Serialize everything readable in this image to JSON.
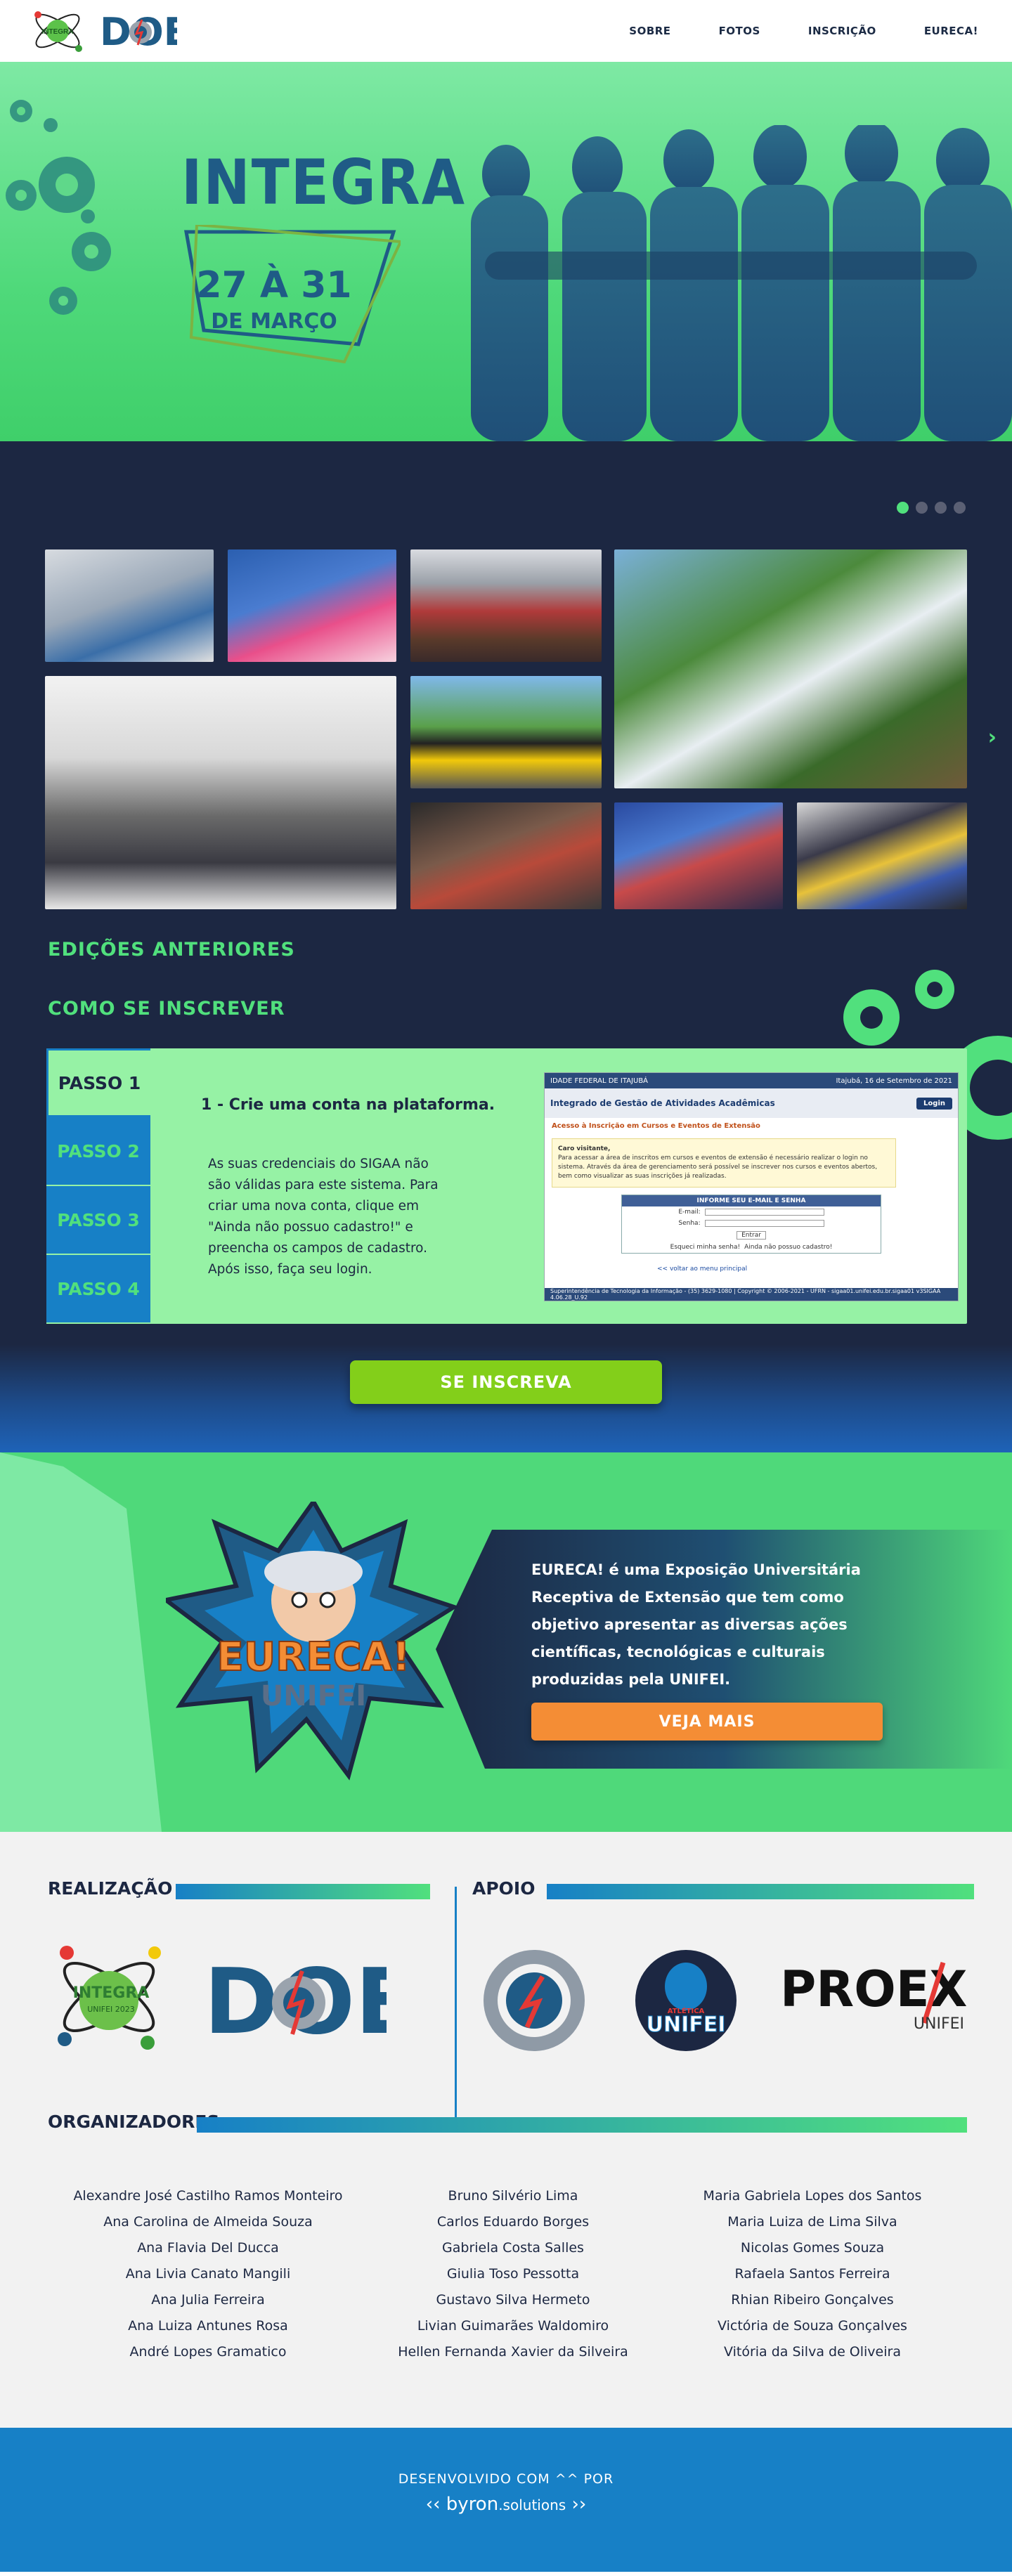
{
  "header": {
    "logos": {
      "integra": "INTEGRA",
      "doe": "DOE"
    },
    "nav": [
      "SOBRE",
      "FOTOS",
      "INSCRIÇÃO",
      "EURECA!"
    ]
  },
  "hero": {
    "title": "INTEGRA",
    "date_days": "27 À 31",
    "date_month": "DE MARÇO"
  },
  "editions": {
    "title": "EDIÇÕES ANTERIORES",
    "page_count": 4,
    "active_page": 1
  },
  "enroll": {
    "title": "COMO SE INSCREVER",
    "steps": [
      "PASSO 1",
      "PASSO 2",
      "PASSO 3",
      "PASSO 4"
    ],
    "active_step": 1,
    "step_heading": "1 - Crie uma conta na plataforma.",
    "step_text": "As suas credenciais do SIGAA não são válidas para este sistema. Para criar uma nova conta, clique em \"Ainda não possuo cadastro!\" e preencha os campos de cadastro. Após isso, faça seu login.",
    "screenshot": {
      "bar_left": "IDADE FEDERAL DE ITAJUBÁ",
      "bar_right": "Itajubá, 16 de Setembro de 2021",
      "subtitle": "Integrado de Gestão de Atividades Acadêmicas",
      "login": "Login",
      "heading": "Acesso à Inscrição em Cursos e Eventos de Extensão",
      "notice_title": "Caro visitante,",
      "notice_text": "Para acessar a área de inscritos em cursos e eventos de extensão é necessário realizar o login no sistema. Através da área de gerenciamento será possível se inscrever nos cursos e eventos abertos, bem como visualizar as suas inscrições já realizadas.",
      "form_title": "INFORME SEU E-MAIL E SENHA",
      "email_label": "E-mail:",
      "password_label": "Senha:",
      "enter": "Entrar",
      "forgot": "Esqueci minha senha!",
      "no_account": "Ainda não possuo cadastro!",
      "back": "<< voltar ao menu principal",
      "footer": "Superintendência de Tecnologia da Informação - (35) 3629-1080 | Copyright © 2006-2021 - UFRN - sigaa01.unifei.edu.br.sigaa01 v3SIGAA 4.06.28_U.92"
    },
    "button": "SE INSCREVA"
  },
  "eureca": {
    "badge_top": "EURECA!",
    "badge_bottom": "UNIFEI",
    "text": "EURECA! é uma Exposição Universitária Receptiva de Extensão que tem como objetivo apresentar as diversas ações científicas, tecnológicas e culturais produzidas pela UNIFEI.",
    "button": "VEJA MAIS"
  },
  "partners": {
    "realizacao_title": "REALIZAÇÃO",
    "apoio_title": "APOIO",
    "organizadores_title": "ORGANIZADORES",
    "logo_labels": {
      "integra": "INTEGRA",
      "integra_sub": "UNIFEI 2023",
      "doe": "DOE",
      "atletica_top": "ATLÉTICA",
      "atletica": "UNIFEI",
      "proex": "PROEX",
      "proex_sub": "UNIFEI"
    },
    "organizers": [
      [
        "Alexandre José Castilho Ramos Monteiro",
        "Ana Carolina de Almeida Souza",
        "Ana Flavia Del Ducca",
        "Ana Livia Canato Mangili",
        "Ana Julia Ferreira",
        "Ana Luiza Antunes Rosa",
        "André Lopes Gramatico"
      ],
      [
        "Bruno Silvério Lima",
        "Carlos Eduardo Borges",
        "Gabriela Costa Salles",
        "Giulia Toso Pessotta",
        "Gustavo Silva Hermeto",
        "Livian Guimarães Waldomiro",
        "Hellen Fernanda Xavier da Silveira"
      ],
      [
        "Maria Gabriela Lopes dos Santos",
        "Maria Luiza de Lima Silva",
        "Nicolas Gomes Souza",
        "Rafaela Santos Ferreira",
        "Rhian Ribeiro Gonçalves",
        "Victória de Souza Gonçalves",
        "Vitória da Silva de Oliveira"
      ]
    ]
  },
  "footer": {
    "developed_by": "DESENVOLVIDO COM ^^ POR",
    "brand": "byron",
    "brand_suffix": ".solutions"
  }
}
